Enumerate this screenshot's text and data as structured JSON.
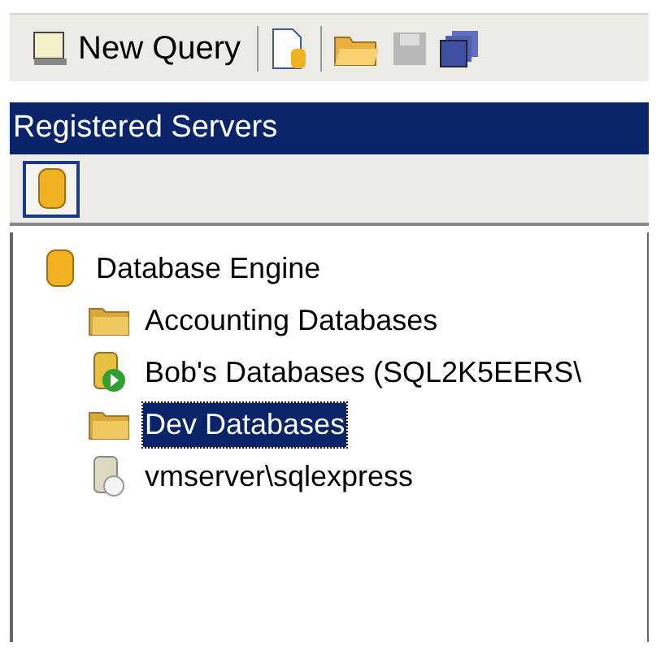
{
  "toolbar": {
    "new_query": "New Query"
  },
  "panel": {
    "title": "Registered Servers",
    "tree": [
      {
        "label": "Database Engine",
        "kind": "engine",
        "selected": false,
        "children": [
          {
            "label": "Accounting Databases",
            "kind": "folder",
            "selected": false
          },
          {
            "label": "Bob's Databases (SQL2K5EERS\\",
            "kind": "server-running",
            "selected": false
          },
          {
            "label": "Dev Databases",
            "kind": "folder",
            "selected": true
          },
          {
            "label": "vmserver\\sqlexpress",
            "kind": "server",
            "selected": false
          }
        ]
      }
    ]
  }
}
